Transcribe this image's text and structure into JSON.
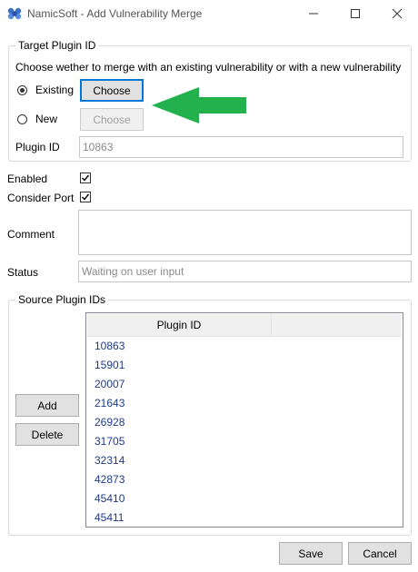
{
  "window": {
    "title": "NamicSoft - Add Vulnerability Merge",
    "minimize_icon": "minimize-icon",
    "maximize_icon": "maximize-icon",
    "close_icon": "close-icon"
  },
  "target_group": {
    "legend": "Target Plugin ID",
    "instruction": "Choose wether to merge with an existing vulnerability or with a new vulnerability",
    "existing_label": "Existing",
    "existing_button": "Choose",
    "existing_selected": true,
    "new_label": "New",
    "new_button": "Choose",
    "plugin_id_label": "Plugin ID",
    "plugin_id_value": "10863"
  },
  "options": {
    "enabled_label": "Enabled",
    "enabled_checked": true,
    "consider_port_label": "Consider Port",
    "consider_port_checked": true,
    "comment_label": "Comment",
    "comment_value": "",
    "status_label": "Status",
    "status_value": "Waiting on user input"
  },
  "source_group": {
    "legend": "Source Plugin IDs",
    "add_button": "Add",
    "delete_button": "Delete",
    "column_header": "Plugin ID",
    "rows": [
      "10863",
      "15901",
      "20007",
      "21643",
      "26928",
      "31705",
      "32314",
      "42873",
      "45410",
      "45411"
    ]
  },
  "footer": {
    "save_button": "Save",
    "cancel_button": "Cancel"
  },
  "annotation": {
    "arrow_color": "#22b14c",
    "arrow_icon": "green-arrow-left-icon"
  }
}
